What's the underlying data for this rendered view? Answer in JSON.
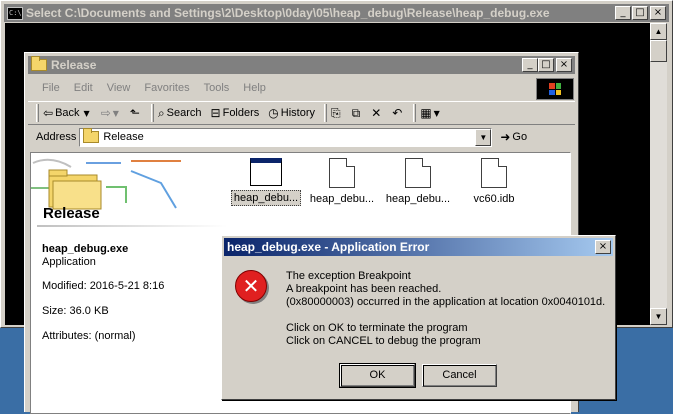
{
  "console": {
    "title": "Select C:\\Documents and Settings\\2\\Desktop\\0day\\05\\heap_debug\\Release\\heap_debug.exe",
    "icon": "cmd-icon",
    "icon_text": "C:\\",
    "controls": {
      "minimize": "_",
      "maximize": "□",
      "close": "×"
    },
    "scroll_up": "▲",
    "scroll_down": "▼"
  },
  "explorer": {
    "title": "Release",
    "controls": {
      "minimize": "_",
      "maximize": "□",
      "close": "×"
    },
    "menu": [
      "File",
      "Edit",
      "View",
      "Favorites",
      "Tools",
      "Help"
    ],
    "toolbar": {
      "back": "Back",
      "forward": "",
      "search": "Search",
      "folders": "Folders",
      "history": "History"
    },
    "address": {
      "label": "Address",
      "value": "Release",
      "go": "Go"
    },
    "side_panel": {
      "title": "Release",
      "file_name": "heap_debug.exe",
      "file_type": "Application",
      "modified": "Modified: 2016-5-21 8:16",
      "size": "Size: 36.0 KB",
      "attributes": "Attributes: (normal)"
    },
    "files": [
      {
        "label": "heap_debu...",
        "icon": "application-icon",
        "selected": true
      },
      {
        "label": "heap_debu...",
        "icon": "document-icon",
        "selected": false
      },
      {
        "label": "heap_debu...",
        "icon": "document-icon",
        "selected": false
      },
      {
        "label": "vc60.idb",
        "icon": "document-icon",
        "selected": false
      }
    ]
  },
  "dialog": {
    "title": "heap_debug.exe - Application Error",
    "close": "×",
    "icon": "error-icon",
    "icon_glyph": "✕",
    "lines": [
      "The exception Breakpoint",
      "A breakpoint has been reached.",
      "(0x80000003) occurred in the application at location 0x0040101d.",
      "Click on OK to terminate the program",
      "Click on CANCEL to debug the program"
    ],
    "ok": "OK",
    "cancel": "Cancel"
  }
}
